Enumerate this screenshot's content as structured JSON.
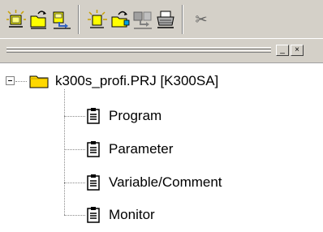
{
  "toolbar": {
    "buttons": [
      {
        "icon": "new-project-icon"
      },
      {
        "icon": "open-project-icon"
      },
      {
        "icon": "save-project-icon"
      },
      {
        "icon": "new-icon"
      },
      {
        "icon": "open-icon"
      },
      {
        "icon": "save-icon"
      },
      {
        "icon": "print-icon"
      },
      {
        "icon": "cut-icon"
      }
    ]
  },
  "pane": {
    "minimize_label": "_",
    "close_label": "×"
  },
  "tree": {
    "root": {
      "label": "k300s_profi.PRJ [K300SA]",
      "expanded": true,
      "expander": "−"
    },
    "items": [
      {
        "label": "Program"
      },
      {
        "label": "Parameter"
      },
      {
        "label": "Variable/Comment"
      },
      {
        "label": "Monitor"
      }
    ]
  }
}
